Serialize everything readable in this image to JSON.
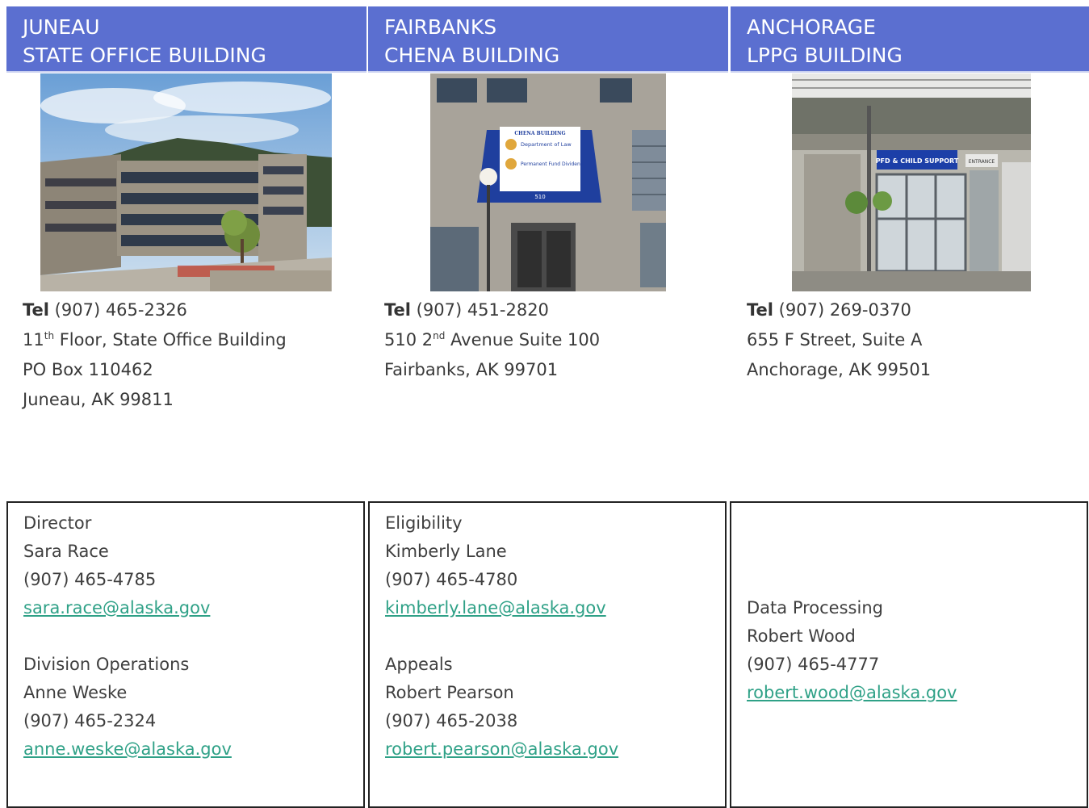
{
  "offices": [
    {
      "line1": "JUNEAU",
      "line2": "STATE OFFICE BUILDING",
      "tel_label": "Tel",
      "tel": "(907) 465-2326",
      "addr1_pre": "11",
      "addr1_sup": "th",
      "addr1_post": " Floor, State Office Building",
      "addr2": "PO Box 110462",
      "addr3": "Juneau, AK 99811"
    },
    {
      "line1": "FAIRBANKS",
      "line2": "CHENA BUILDING",
      "tel_label": "Tel",
      "tel": "(907) 451-2820",
      "addr1_pre": "510 2",
      "addr1_sup": "nd",
      "addr1_post": " Avenue Suite 100",
      "addr2": "Fairbanks, AK 99701",
      "sign": {
        "title": "CHENA BUILDING",
        "row1": "Department of Law",
        "row2": "Permanent Fund Dividend",
        "number": "510"
      }
    },
    {
      "line1": "ANCHORAGE",
      "line2": "LPPG BUILDING",
      "tel_label": "Tel",
      "tel": "(907) 269-0370",
      "addr1": "655 F Street, Suite A",
      "addr2": "Anchorage, AK 99501",
      "sign": {
        "main": "PFD & CHILD SUPPORT",
        "side": "ENTRANCE"
      }
    }
  ],
  "contacts": [
    [
      {
        "role": "Director",
        "name": "Sara Race",
        "phone": "(907) 465-4785",
        "email": "sara.race@alaska.gov"
      },
      {
        "role": "Division Operations",
        "name": "Anne Weske",
        "phone": "(907) 465-2324",
        "email": "anne.weske@alaska.gov"
      }
    ],
    [
      {
        "role": "Eligibility",
        "name": "Kimberly Lane",
        "phone": "(907) 465-4780",
        "email": "kimberly.lane@alaska.gov"
      },
      {
        "role": "Appeals",
        "name": "Robert Pearson",
        "phone": "(907) 465-2038",
        "email": "robert.pearson@alaska.gov"
      }
    ],
    [
      {
        "role": "Data Processing",
        "name": "Robert Wood",
        "phone": "(907) 465-4777",
        "email": "robert.wood@alaska.gov"
      }
    ]
  ],
  "colors": {
    "header_bg": "#5b6fd0",
    "link": "#2fa187"
  }
}
